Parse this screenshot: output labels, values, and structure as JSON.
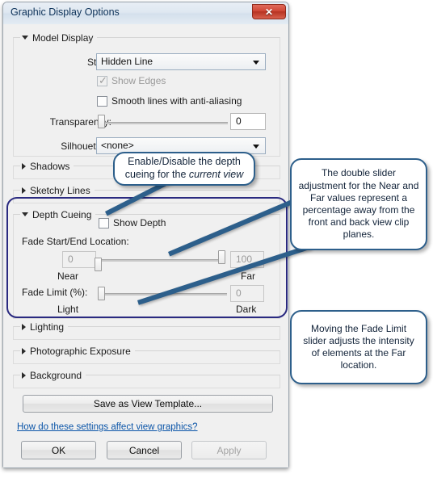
{
  "window": {
    "title": "Graphic Display Options",
    "close_label": "✕"
  },
  "sections": {
    "model_display": {
      "label": "Model Display",
      "expanded": true,
      "style_label": "Style:",
      "style_value": "Hidden Line",
      "show_edges_label": "Show Edges",
      "show_edges_checked": true,
      "show_edges_enabled": false,
      "smooth_lines_label": "Smooth lines with anti-aliasing",
      "smooth_lines_checked": false,
      "transparency_label": "Transparency:",
      "transparency_value": "0",
      "silhouettes_label": "Silhouettes:",
      "silhouettes_value": "<none>"
    },
    "shadows": {
      "label": "Shadows",
      "expanded": false
    },
    "sketchy_lines": {
      "label": "Sketchy Lines",
      "expanded": false
    },
    "depth_cueing": {
      "label": "Depth Cueing",
      "expanded": true,
      "show_depth_label": "Show Depth",
      "show_depth_checked": false,
      "fade_location_label": "Fade Start/End Location:",
      "near_value": "0",
      "far_value": "100",
      "near_label": "Near",
      "far_label": "Far",
      "fade_limit_label": "Fade Limit (%):",
      "fade_limit_value": "0",
      "light_label": "Light",
      "dark_label": "Dark"
    },
    "lighting": {
      "label": "Lighting",
      "expanded": false
    },
    "photographic_exposure": {
      "label": "Photographic Exposure",
      "expanded": false
    },
    "background": {
      "label": "Background",
      "expanded": false
    }
  },
  "footer": {
    "save_template_label": "Save as View Template...",
    "help_link_label": "How do these settings affect view graphics?",
    "ok_label": "OK",
    "cancel_label": "Cancel",
    "apply_label": "Apply",
    "apply_enabled": false
  },
  "callouts": [
    {
      "id": "depth-cueing-toggle",
      "line1": "Enable/Disable the depth",
      "line2_pre": "cueing for the ",
      "line2_em": "current view"
    },
    {
      "id": "near-far-sliders",
      "text": "The double slider adjustment for the Near and Far values represent a percentage away from the front and back view clip planes."
    },
    {
      "id": "fade-limit-slider",
      "text": "Moving the Fade Limit slider adjusts the intensity of elements at the Far location."
    }
  ],
  "colors": {
    "callout_border": "#2d5f8b",
    "highlight_ring": "#2a2a80",
    "link": "#0b55a8",
    "title_text": "#0d3259",
    "close_button": "#d14836"
  }
}
